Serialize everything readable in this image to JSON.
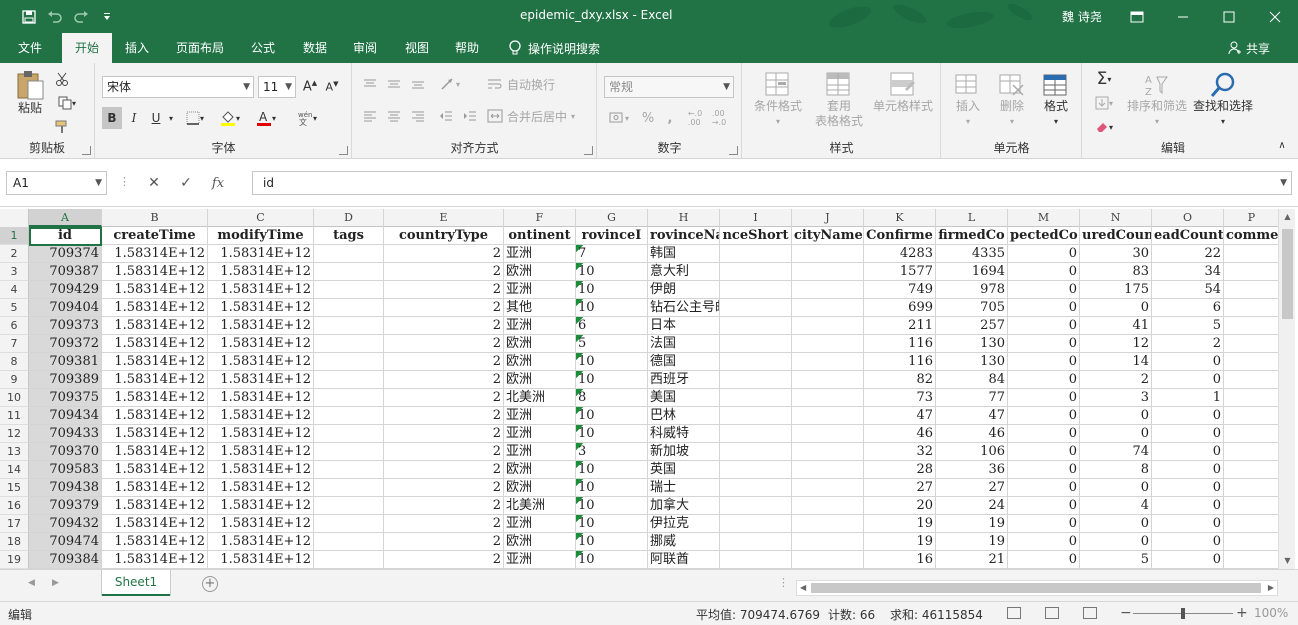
{
  "app": {
    "title": "epidemic_dxy.xlsx  -  Excel",
    "user": "魏 诗尧",
    "accent": "#217346"
  },
  "tabs": [
    "文件",
    "开始",
    "插入",
    "页面布局",
    "公式",
    "数据",
    "审阅",
    "视图",
    "帮助"
  ],
  "search_label": "操作说明搜索",
  "share_label": "共享",
  "ribbon": {
    "clipboard": {
      "paste": "粘贴",
      "label": "剪贴板"
    },
    "font": {
      "name": "宋体",
      "size": "11",
      "label": "字体",
      "bold": "B",
      "italic": "I",
      "underline": "U"
    },
    "alignment": {
      "wrap": "自动换行",
      "merge": "合并后居中",
      "label": "对齐方式"
    },
    "number": {
      "format": "常规",
      "label": "数字"
    },
    "styles": {
      "conditional": "条件格式",
      "table": "套用\n表格格式",
      "cell": "单元格样式",
      "label": "样式"
    },
    "cells": {
      "insert": "插入",
      "delete": "删除",
      "format": "格式",
      "label": "单元格"
    },
    "editing": {
      "sort": "排序和筛选",
      "find": "查找和选择",
      "label": "编辑"
    }
  },
  "formula_bar": {
    "name_box": "A1",
    "content": "id",
    "fx": "fx"
  },
  "columns": [
    "A",
    "B",
    "C",
    "D",
    "E",
    "F",
    "G",
    "H",
    "I",
    "J",
    "K",
    "L",
    "M",
    "N",
    "O",
    "P"
  ],
  "headers": [
    "id",
    "createTime",
    "modifyTime",
    "tags",
    "countryType",
    "ontinent",
    "rovinceI",
    "rovinceNa",
    "nceShort",
    "cityName",
    "Confirme",
    "firmedCo",
    "pectedCo",
    "uredCoun",
    "eadCount",
    "commen"
  ],
  "rows": [
    [
      "709374",
      "1.58314E+12",
      "1.58314E+12",
      "",
      "2",
      "亚洲",
      "7",
      "韩国",
      "",
      "",
      "4283",
      "4335",
      "0",
      "30",
      "22",
      ""
    ],
    [
      "709387",
      "1.58314E+12",
      "1.58314E+12",
      "",
      "2",
      "欧洲",
      "10",
      "意大利",
      "",
      "",
      "1577",
      "1694",
      "0",
      "83",
      "34",
      ""
    ],
    [
      "709429",
      "1.58314E+12",
      "1.58314E+12",
      "",
      "2",
      "亚洲",
      "10",
      "伊朗",
      "",
      "",
      "749",
      "978",
      "0",
      "175",
      "54",
      ""
    ],
    [
      "709404",
      "1.58314E+12",
      "1.58314E+12",
      "",
      "2",
      "其他",
      "10",
      "钻石公主号邮轮",
      "",
      "",
      "699",
      "705",
      "0",
      "0",
      "6",
      ""
    ],
    [
      "709373",
      "1.58314E+12",
      "1.58314E+12",
      "",
      "2",
      "亚洲",
      "6",
      "日本",
      "",
      "",
      "211",
      "257",
      "0",
      "41",
      "5",
      ""
    ],
    [
      "709372",
      "1.58314E+12",
      "1.58314E+12",
      "",
      "2",
      "欧洲",
      "5",
      "法国",
      "",
      "",
      "116",
      "130",
      "0",
      "12",
      "2",
      ""
    ],
    [
      "709381",
      "1.58314E+12",
      "1.58314E+12",
      "",
      "2",
      "欧洲",
      "10",
      "德国",
      "",
      "",
      "116",
      "130",
      "0",
      "14",
      "0",
      ""
    ],
    [
      "709389",
      "1.58314E+12",
      "1.58314E+12",
      "",
      "2",
      "欧洲",
      "10",
      "西班牙",
      "",
      "",
      "82",
      "84",
      "0",
      "2",
      "0",
      ""
    ],
    [
      "709375",
      "1.58314E+12",
      "1.58314E+12",
      "",
      "2",
      "北美洲",
      "8",
      "美国",
      "",
      "",
      "73",
      "77",
      "0",
      "3",
      "1",
      ""
    ],
    [
      "709434",
      "1.58314E+12",
      "1.58314E+12",
      "",
      "2",
      "亚洲",
      "10",
      "巴林",
      "",
      "",
      "47",
      "47",
      "0",
      "0",
      "0",
      ""
    ],
    [
      "709433",
      "1.58314E+12",
      "1.58314E+12",
      "",
      "2",
      "亚洲",
      "10",
      "科威特",
      "",
      "",
      "46",
      "46",
      "0",
      "0",
      "0",
      ""
    ],
    [
      "709370",
      "1.58314E+12",
      "1.58314E+12",
      "",
      "2",
      "亚洲",
      "3",
      "新加坡",
      "",
      "",
      "32",
      "106",
      "0",
      "74",
      "0",
      ""
    ],
    [
      "709583",
      "1.58314E+12",
      "1.58314E+12",
      "",
      "2",
      "欧洲",
      "10",
      "英国",
      "",
      "",
      "28",
      "36",
      "0",
      "8",
      "0",
      ""
    ],
    [
      "709438",
      "1.58314E+12",
      "1.58314E+12",
      "",
      "2",
      "欧洲",
      "10",
      "瑞士",
      "",
      "",
      "27",
      "27",
      "0",
      "0",
      "0",
      ""
    ],
    [
      "709379",
      "1.58314E+12",
      "1.58314E+12",
      "",
      "2",
      "北美洲",
      "10",
      "加拿大",
      "",
      "",
      "20",
      "24",
      "0",
      "4",
      "0",
      ""
    ],
    [
      "709432",
      "1.58314E+12",
      "1.58314E+12",
      "",
      "2",
      "亚洲",
      "10",
      "伊拉克",
      "",
      "",
      "19",
      "19",
      "0",
      "0",
      "0",
      ""
    ],
    [
      "709474",
      "1.58314E+12",
      "1.58314E+12",
      "",
      "2",
      "欧洲",
      "10",
      "挪威",
      "",
      "",
      "19",
      "19",
      "0",
      "0",
      "0",
      ""
    ],
    [
      "709384",
      "1.58314E+12",
      "1.58314E+12",
      "",
      "2",
      "亚洲",
      "10",
      "阿联酋",
      "",
      "",
      "16",
      "21",
      "0",
      "5",
      "0",
      ""
    ]
  ],
  "sheet_tab": "Sheet1",
  "status": {
    "mode": "编辑",
    "average": "平均值: 709474.6769",
    "count": "计数: 66",
    "sum": "求和: 46115854",
    "zoom": "100%"
  }
}
